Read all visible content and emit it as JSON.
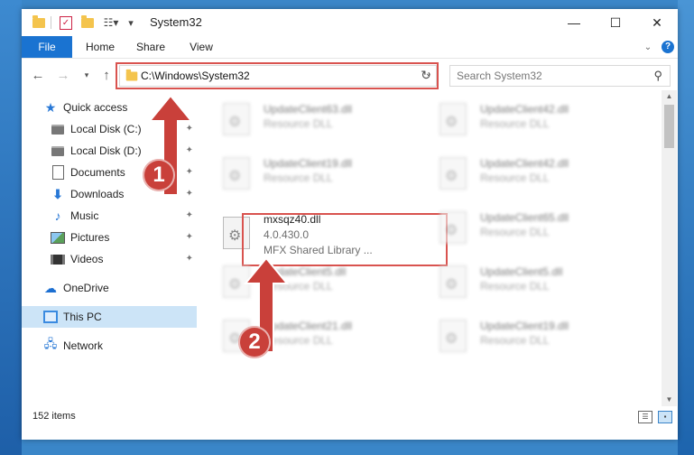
{
  "window": {
    "title": "System32",
    "controls": {
      "minimize": "—",
      "maximize": "☐",
      "close": "✕"
    }
  },
  "ribbon": {
    "tabs": [
      "File",
      "Home",
      "Share",
      "View"
    ],
    "help": "?"
  },
  "nav": {
    "address": "C:\\Windows\\System32",
    "search_placeholder": "Search System32"
  },
  "sidebar": {
    "items": [
      {
        "label": "Quick access",
        "icon": "star-icon"
      },
      {
        "label": "Local Disk (C:)",
        "icon": "drive-icon",
        "pinned": true
      },
      {
        "label": "Local Disk (D:)",
        "icon": "drive-icon",
        "pinned": true
      },
      {
        "label": "Documents",
        "icon": "documents-icon",
        "pinned": true
      },
      {
        "label": "Downloads",
        "icon": "downloads-icon",
        "pinned": true
      },
      {
        "label": "Music",
        "icon": "music-icon",
        "pinned": true
      },
      {
        "label": "Pictures",
        "icon": "pictures-icon",
        "pinned": true
      },
      {
        "label": "Videos",
        "icon": "videos-icon",
        "pinned": true
      },
      {
        "label": "OneDrive",
        "icon": "onedrive-icon"
      },
      {
        "label": "This PC",
        "icon": "this-pc-icon",
        "selected": true
      },
      {
        "label": "Network",
        "icon": "network-icon"
      }
    ]
  },
  "files": {
    "left": [
      {
        "name": "UpdateClient63.dll",
        "type": "Resource DLL"
      },
      {
        "name": "UpdateClient19.dll",
        "type": "Resource DLL"
      },
      {
        "name": "mxsqz40.dll",
        "version": "4.0.430.0",
        "type": "MFX Shared Library ..."
      },
      {
        "name": "UpdateClient5.dll",
        "type": "Resource DLL"
      },
      {
        "name": "UpdateClient21.dll",
        "type": "Resource DLL"
      }
    ],
    "right": [
      {
        "name": "UpdateClient42.dll",
        "type": "Resource DLL"
      },
      {
        "name": "UpdateClient42.dll",
        "type": "Resource DLL"
      },
      {
        "name": "UpdateClient65.dll",
        "type": "Resource DLL"
      },
      {
        "name": "UpdateClient5.dll",
        "type": "Resource DLL"
      },
      {
        "name": "UpdateClient19.dll",
        "type": "Resource DLL"
      }
    ]
  },
  "status": {
    "count": "152 items"
  },
  "annotations": {
    "step1": "1",
    "step2": "2",
    "color": "#c9403a"
  }
}
